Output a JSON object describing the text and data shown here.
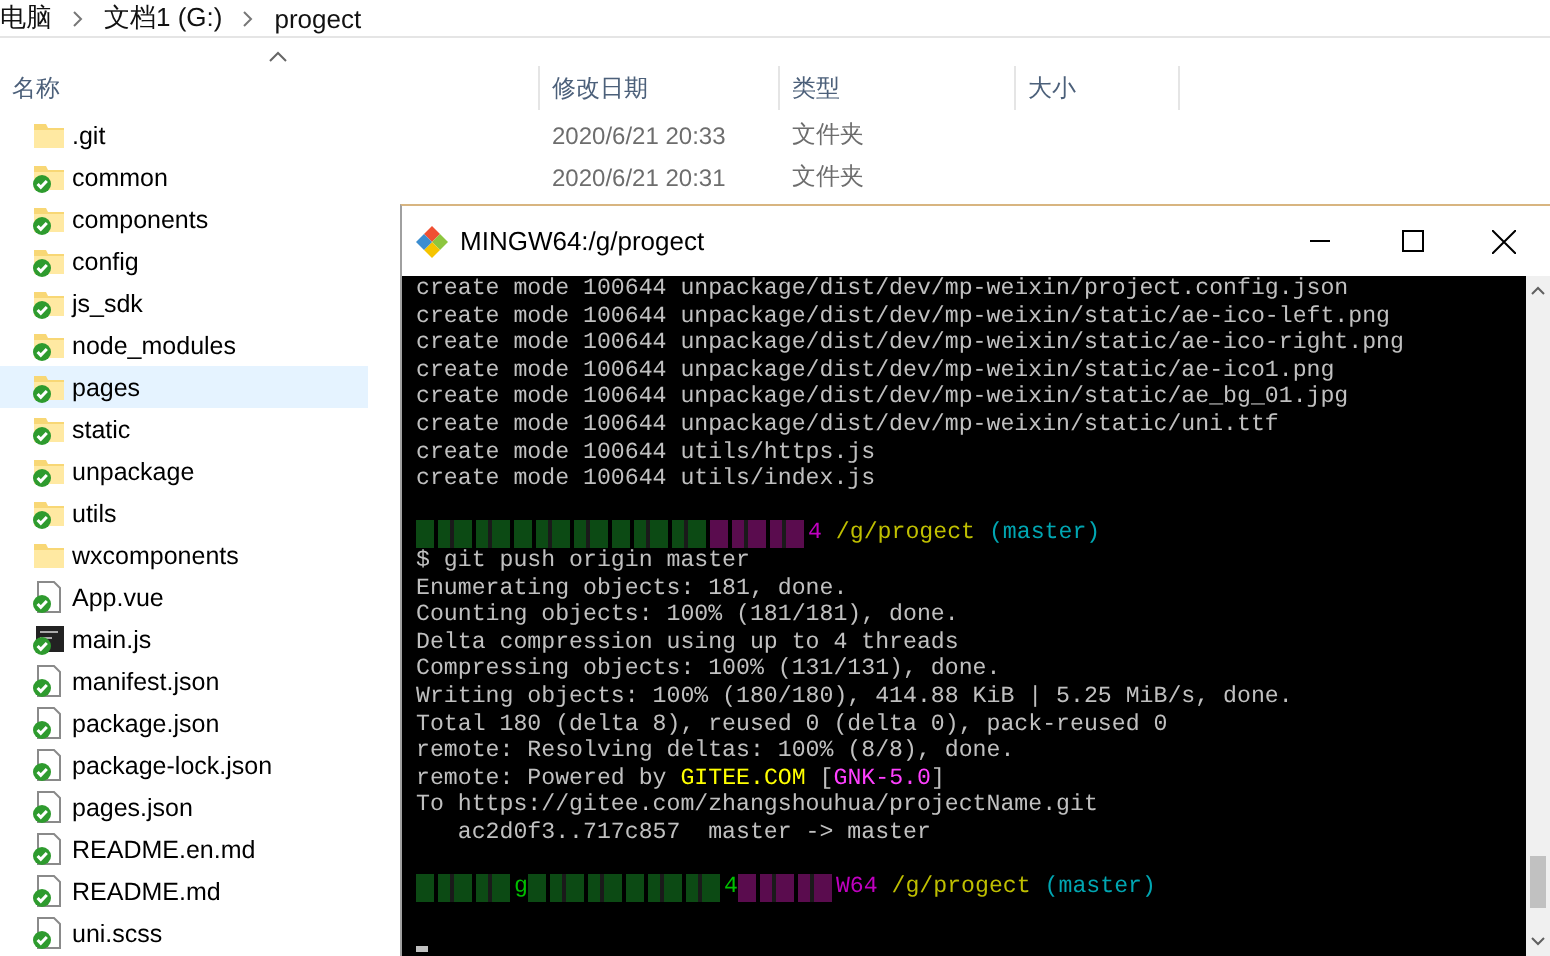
{
  "breadcrumb": [
    "电脑",
    "文档1 (G:)",
    "progect"
  ],
  "columns": [
    "名称",
    "修改日期",
    "类型",
    "大小"
  ],
  "files": [
    {
      "name": ".git",
      "kind": "folder",
      "synced": false,
      "selected": false,
      "modified": "2020/6/21 20:33",
      "type": "文件夹"
    },
    {
      "name": "common",
      "kind": "folder",
      "synced": true,
      "selected": false,
      "modified": "2020/6/21 20:31",
      "type": "文件夹"
    },
    {
      "name": "components",
      "kind": "folder",
      "synced": true,
      "selected": false
    },
    {
      "name": "config",
      "kind": "folder",
      "synced": true,
      "selected": false
    },
    {
      "name": "js_sdk",
      "kind": "folder",
      "synced": true,
      "selected": false
    },
    {
      "name": "node_modules",
      "kind": "folder",
      "synced": true,
      "selected": false
    },
    {
      "name": "pages",
      "kind": "folder",
      "synced": true,
      "selected": true
    },
    {
      "name": "static",
      "kind": "folder",
      "synced": true,
      "selected": false
    },
    {
      "name": "unpackage",
      "kind": "folder",
      "synced": true,
      "selected": false
    },
    {
      "name": "utils",
      "kind": "folder",
      "synced": true,
      "selected": false
    },
    {
      "name": "wxcomponents",
      "kind": "folder",
      "synced": false,
      "selected": false
    },
    {
      "name": "App.vue",
      "kind": "file",
      "synced": true,
      "selected": false
    },
    {
      "name": "main.js",
      "kind": "script",
      "synced": true,
      "selected": false
    },
    {
      "name": "manifest.json",
      "kind": "file",
      "synced": true,
      "selected": false
    },
    {
      "name": "package.json",
      "kind": "file",
      "synced": true,
      "selected": false
    },
    {
      "name": "package-lock.json",
      "kind": "file",
      "synced": true,
      "selected": false
    },
    {
      "name": "pages.json",
      "kind": "file",
      "synced": true,
      "selected": false
    },
    {
      "name": "README.en.md",
      "kind": "file",
      "synced": true,
      "selected": false
    },
    {
      "name": "README.md",
      "kind": "file",
      "synced": true,
      "selected": false
    },
    {
      "name": "uni.scss",
      "kind": "file",
      "synced": true,
      "selected": false
    }
  ],
  "terminal": {
    "title": "MINGW64:/g/progect",
    "blocks": [
      [
        [
          {
            "kind": "text",
            "text": "create mode 100644 unpackage/dist/dev/mp-weixin/project.config.json",
            "color": "#c0c0c0"
          }
        ],
        [
          {
            "kind": "text",
            "text": "create mode 100644 unpackage/dist/dev/mp-weixin/static/ae-ico-left.png",
            "color": "#c0c0c0"
          }
        ],
        [
          {
            "kind": "text",
            "text": "create mode 100644 unpackage/dist/dev/mp-weixin/static/ae-ico-right.png",
            "color": "#c0c0c0"
          }
        ],
        [
          {
            "kind": "text",
            "text": "create mode 100644 unpackage/dist/dev/mp-weixin/static/ae-ico1.png",
            "color": "#c0c0c0"
          }
        ],
        [
          {
            "kind": "text",
            "text": "create mode 100644 unpackage/dist/dev/mp-weixin/static/ae_bg_01.jpg",
            "color": "#c0c0c0"
          }
        ],
        [
          {
            "kind": "text",
            "text": "create mode 100644 unpackage/dist/dev/mp-weixin/static/uni.ttf",
            "color": "#c0c0c0"
          }
        ],
        [
          {
            "kind": "text",
            "text": "create mode 100644 utils/https.js",
            "color": "#c0c0c0"
          }
        ],
        [
          {
            "kind": "text",
            "text": "create mode 100644 utils/index.js",
            "color": "#c0c0c0"
          }
        ]
      ],
      [
        [
          {
            "kind": "redacted",
            "color": "#0c4a14"
          },
          {
            "kind": "redacted",
            "color": "#0c4a14"
          },
          {
            "kind": "redacted",
            "color": "#0c4a14"
          },
          {
            "kind": "redacted",
            "color": "#5a0c4e"
          },
          {
            "kind": "text",
            "text": "4",
            "color": "#c000c0"
          },
          {
            "kind": "text",
            "text": " /g/progect",
            "color": "#bfbf00"
          },
          {
            "kind": "text",
            "text": " (master)",
            "color": "#00a6b2"
          }
        ],
        [
          {
            "kind": "text",
            "text": "$ git push origin master",
            "color": "#c0c0c0"
          }
        ],
        [
          {
            "kind": "text",
            "text": "Enumerating objects: 181, done.",
            "color": "#c0c0c0"
          }
        ],
        [
          {
            "kind": "text",
            "text": "Counting objects: 100% (181/181), done.",
            "color": "#c0c0c0"
          }
        ],
        [
          {
            "kind": "text",
            "text": "Delta compression using up to 4 threads",
            "color": "#c0c0c0"
          }
        ],
        [
          {
            "kind": "text",
            "text": "Compressing objects: 100% (131/131), done.",
            "color": "#c0c0c0"
          }
        ],
        [
          {
            "kind": "text",
            "text": "Writing objects: 100% (180/180), 414.88 KiB | 5.25 MiB/s, done.",
            "color": "#c0c0c0"
          }
        ],
        [
          {
            "kind": "text",
            "text": "Total 180 (delta 8), reused 0 (delta 0), pack-reused 0",
            "color": "#c0c0c0"
          }
        ],
        [
          {
            "kind": "text",
            "text": "remote: Resolving deltas: 100% (8/8), done.",
            "color": "#c0c0c0"
          }
        ],
        [
          {
            "kind": "text",
            "text": "remote: Powered by ",
            "color": "#c0c0c0"
          },
          {
            "kind": "text",
            "text": "GITEE.COM",
            "color": "#ffff00"
          },
          {
            "kind": "text",
            "text": " [",
            "color": "#c0c0c0"
          },
          {
            "kind": "text",
            "text": "GNK-5.0",
            "color": "#ff40ff"
          },
          {
            "kind": "text",
            "text": "]",
            "color": "#c0c0c0"
          }
        ],
        [
          {
            "kind": "text",
            "text": "To https://gitee.com/zhangshouhua/projectName.git",
            "color": "#c0c0c0"
          }
        ],
        [
          {
            "kind": "text",
            "text": "   ac2d0f3..717c857  master -> master",
            "color": "#c0c0c0"
          }
        ]
      ],
      [
        [
          {
            "kind": "redacted",
            "color": "#0c4a14"
          },
          {
            "kind": "text",
            "text": "g",
            "color": "#00c000"
          },
          {
            "kind": "redacted",
            "color": "#0c4a14"
          },
          {
            "kind": "redacted",
            "color": "#0c4a14"
          },
          {
            "kind": "text",
            "text": "4",
            "color": "#00c000"
          },
          {
            "kind": "redacted",
            "color": "#5a0c4e"
          },
          {
            "kind": "text",
            "text": "W64",
            "color": "#c000c0"
          },
          {
            "kind": "text",
            "text": " /g/progect",
            "color": "#bfbf00"
          },
          {
            "kind": "text",
            "text": " (master)",
            "color": "#00a6b2"
          }
        ]
      ]
    ]
  }
}
